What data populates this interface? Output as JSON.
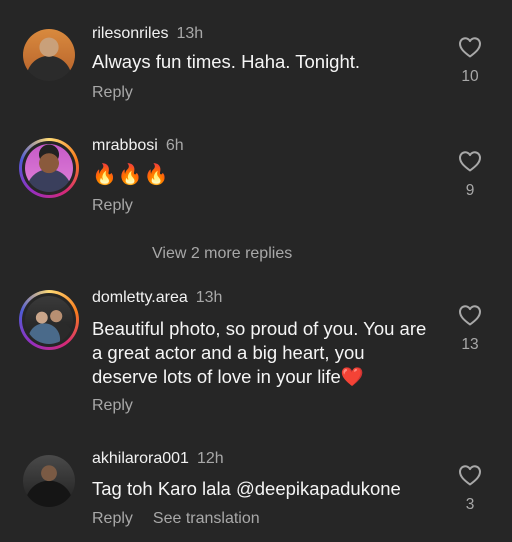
{
  "comments": [
    {
      "username": "rilesonriles",
      "time": "13h",
      "text": "Always fun times. Haha. Tonight.",
      "reply_label": "Reply",
      "likes": "10",
      "avatar_ring": false
    },
    {
      "username": "mrabbosi",
      "time": "6h",
      "text": "🔥🔥🔥",
      "reply_label": "Reply",
      "likes": "9",
      "avatar_ring": true
    },
    {
      "username": "domletty.area",
      "time": "13h",
      "text": "Beautiful photo, so proud of you. You are a great actor and a big heart, you deserve lots of love in your life❤️",
      "reply_label": "Reply",
      "likes": "13",
      "avatar_ring": true
    },
    {
      "username": "akhilarora001",
      "time": "12h",
      "text": "Tag toh Karo lala @deepikapadukone",
      "reply_label": "Reply",
      "see_translation_label": "See translation",
      "likes": "3",
      "avatar_ring": false
    }
  ],
  "view_more_replies_label": "View 2 more replies",
  "icons": {
    "like": "heart-outline-icon"
  },
  "colors": {
    "background": "#262626",
    "text_primary": "#f2f2f2",
    "text_secondary": "#a8a8a8"
  }
}
